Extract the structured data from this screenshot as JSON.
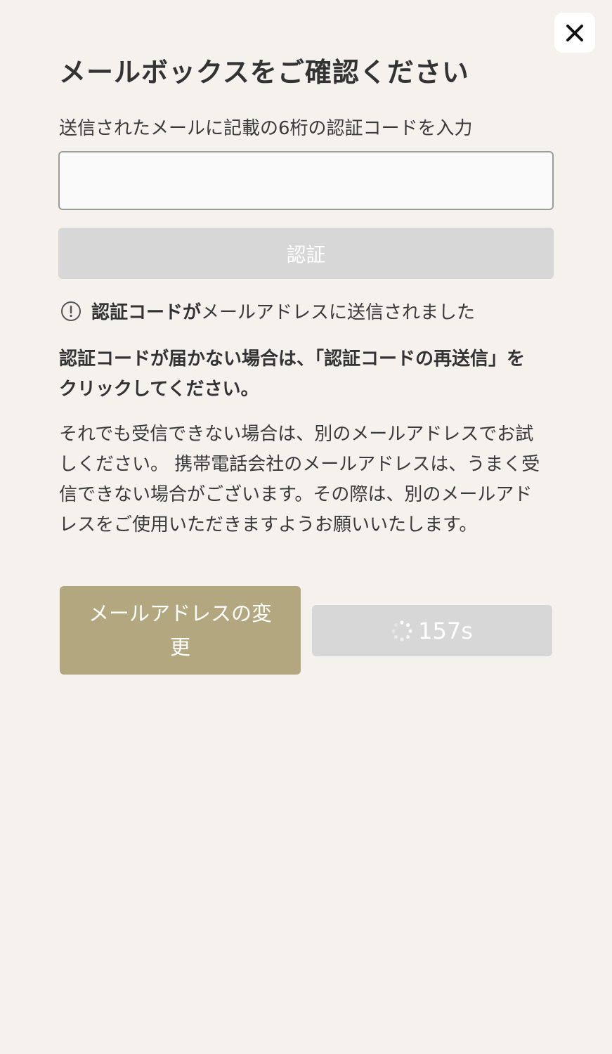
{
  "dialog": {
    "title": "メールボックスをご確認ください",
    "close_icon": "close-icon"
  },
  "form": {
    "instruction": "送信されたメールに記載の6桁の認証コードを入力",
    "code_value": "",
    "code_placeholder": "",
    "verify_label": "認証"
  },
  "notice": {
    "icon": "exclamation-circle-icon",
    "strong_text": "認証コードが",
    "rest_text": "メールアドレスに送信されました"
  },
  "resend_hint": "認証コードが届かない場合は、「認証コードの再送信」をクリックしてください。",
  "help_text": "それでも受信できない場合は、別のメールアドレスでお試しください。 携帯電話会社のメールアドレスは、うまく受信できない場合がございます。その際は、別のメールアドレスをご使用いただきますようお願いいたします。",
  "actions": {
    "change_email_label": "メールアドレスの変更",
    "resend_countdown": "157s",
    "resend_icon": "spinner-icon"
  },
  "colors": {
    "background": "#f5f2ed",
    "primary_button": "#b3a780",
    "disabled_button": "#d7d7d7"
  }
}
